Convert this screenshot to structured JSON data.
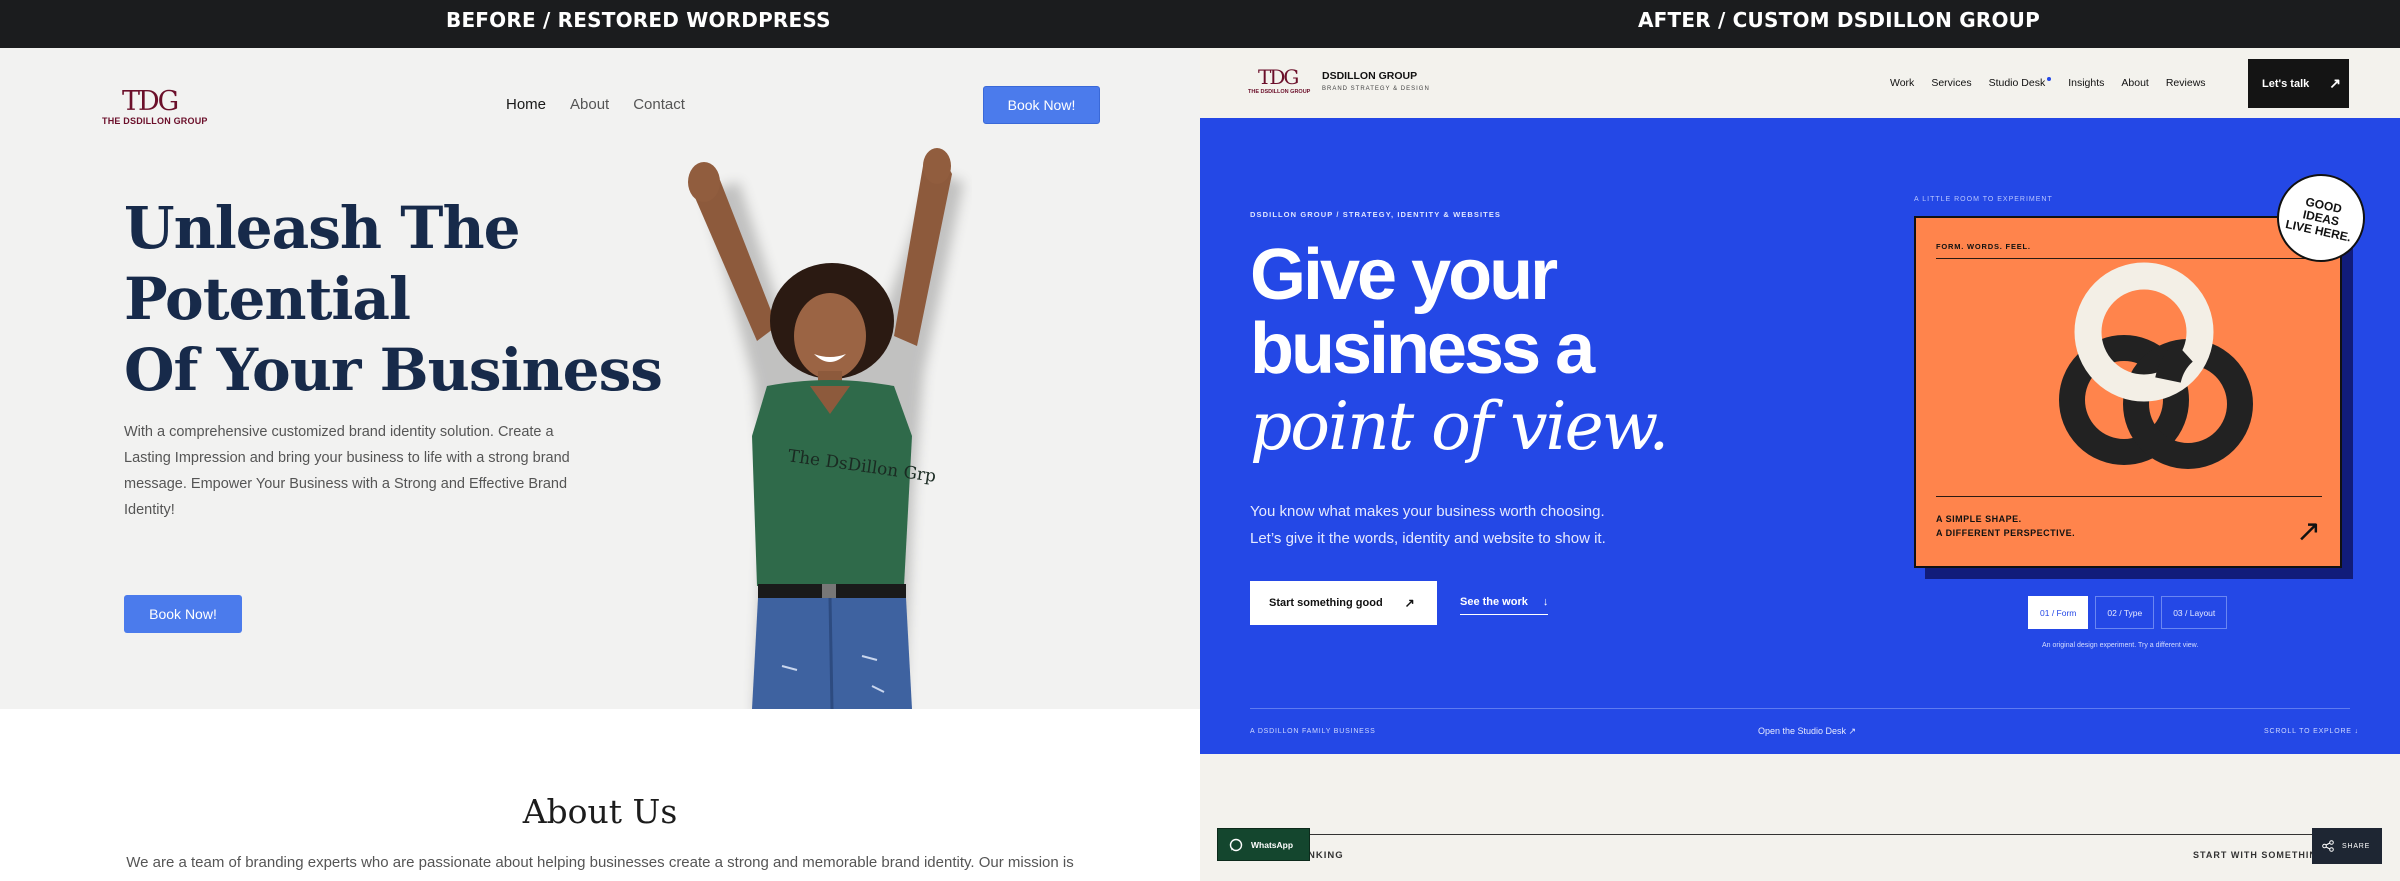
{
  "captions": {
    "before": "BEFORE / RESTORED WORDPRESS",
    "after": "AFTER / CUSTOM DSDILLON GROUP"
  },
  "before": {
    "logo": {
      "mark": "TDG",
      "sub": "THE DSDILLON GROUP"
    },
    "nav": [
      "Home",
      "About",
      "Contact"
    ],
    "book_label": "Book Now!",
    "hero_title": [
      "Unleash The",
      "Potential",
      "Of Your Business"
    ],
    "hero_body": "With a comprehensive customized brand identity solution. Create a Lasting Impression and bring your business to life with a strong brand message. Empower Your Business with a Strong and Effective Brand Identity!",
    "hero_book_label": "Book Now!",
    "shirt_text": "The DsDillon Grp",
    "about_heading": "About Us",
    "about_text": "We are a team of branding experts who are passionate about helping businesses create a strong and memorable brand identity. Our mission is"
  },
  "after": {
    "logo": {
      "mark": "TDG",
      "sub": "THE DSDILLON GROUP"
    },
    "brand_name": "DSDILLON GROUP",
    "brand_tag": "BRAND STRATEGY & DESIGN",
    "nav": [
      "Work",
      "Services",
      "Studio Desk",
      "Insights",
      "About",
      "Reviews"
    ],
    "talk_label": "Let's talk",
    "kicker": "DSDILLON GROUP / STRATEGY, IDENTITY & WEBSITES",
    "title_lines": [
      "Give your",
      "business a"
    ],
    "title_italic": "point of view.",
    "body_lines": [
      "You know what makes your business worth choosing.",
      "Let’s give it the words, identity and website to show it."
    ],
    "start_label": "Start something good",
    "see_label": "See the work",
    "room_label": "A LITTLE ROOM TO EXPERIMENT",
    "card_kicker": "FORM. WORDS. FEEL.",
    "card_caption": [
      "A SIMPLE SHAPE.",
      "A DIFFERENT PERSPECTIVE."
    ],
    "badge_lines": [
      "GOOD",
      "IDEAS",
      "LIVE HERE."
    ],
    "tabs": [
      "01 / Form",
      "02 / Type",
      "03 / Layout"
    ],
    "tab_note": "An original design experiment. Try a different view.",
    "family_label": "A DSDILLON FAMILY BUSINESS",
    "studio_link": "Open the Studio Desk ↗",
    "scroll_label": "SCROLL TO EXPLORE ↓",
    "lower_left": "NKING",
    "lower_right": "START WITH SOMETHING",
    "whatsapp_label": "WhatsApp",
    "share_label": "SHARE"
  },
  "colors": {
    "accent_blue": "#2448e6",
    "orange": "#ff844c",
    "button_blue": "#4b7bec",
    "navy": "#172a4a",
    "brand_maroon": "#6b0f2a"
  }
}
